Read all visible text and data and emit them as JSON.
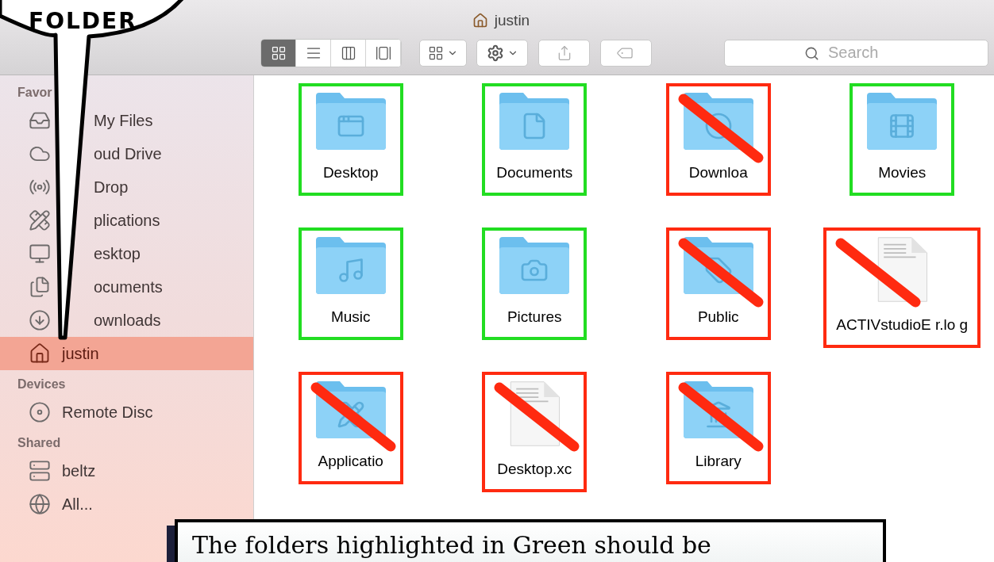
{
  "window": {
    "title": "justin"
  },
  "toolbar": {
    "view_buttons": [
      {
        "selected": true
      },
      {
        "selected": false
      },
      {
        "selected": false
      },
      {
        "selected": false
      }
    ],
    "search": {
      "placeholder": "Search"
    }
  },
  "sidebar": {
    "sections": [
      {
        "header": "Favor",
        "items": [
          {
            "label": "My Files",
            "selected": false
          },
          {
            "label": "oud Drive",
            "selected": false
          },
          {
            "label": "Drop",
            "selected": false
          },
          {
            "label": "plications",
            "selected": false
          },
          {
            "label": "esktop",
            "selected": false
          },
          {
            "label": "ocuments",
            "selected": false
          },
          {
            "label": "ownloads",
            "selected": false
          },
          {
            "label": "justin",
            "selected": true
          }
        ]
      },
      {
        "header": "Devices",
        "items": [
          {
            "label": "Remote Disc",
            "selected": false
          }
        ]
      },
      {
        "header": "Shared",
        "items": [
          {
            "label": "beltz",
            "selected": false
          },
          {
            "label": "All...",
            "selected": false
          }
        ]
      }
    ]
  },
  "files": [
    {
      "label": "Desktop",
      "kind": "folder",
      "color": "#22dd22",
      "crossed_out": false
    },
    {
      "label": "Documents",
      "kind": "folder",
      "color": "#22dd22",
      "crossed_out": false
    },
    {
      "label": "Downloa",
      "kind": "folder",
      "color": "#ff2a10",
      "crossed_out": true
    },
    {
      "label": "Movies",
      "kind": "folder",
      "color": "#22dd22",
      "crossed_out": false
    },
    {
      "label": "Music",
      "kind": "folder",
      "color": "#22dd22",
      "crossed_out": false
    },
    {
      "label": "Pictures",
      "kind": "folder",
      "color": "#22dd22",
      "crossed_out": false
    },
    {
      "label": "Public",
      "kind": "folder",
      "color": "#ff2a10",
      "crossed_out": true
    },
    {
      "label": "ACTIVstudioE r.lo g",
      "kind": "document",
      "color": "#ff2a10",
      "crossed_out": true
    },
    {
      "label": "Applicatio",
      "kind": "folder",
      "color": "#ff2a10",
      "crossed_out": true
    },
    {
      "label": "Desktop.xc",
      "kind": "document",
      "color": "#ff2a10",
      "crossed_out": true
    },
    {
      "label": "Library",
      "kind": "folder",
      "color": "#ff2a10",
      "crossed_out": true
    }
  ],
  "callout": {
    "text": "FOLDER"
  },
  "caption": {
    "text": "The folders highlighted in Green should be"
  }
}
